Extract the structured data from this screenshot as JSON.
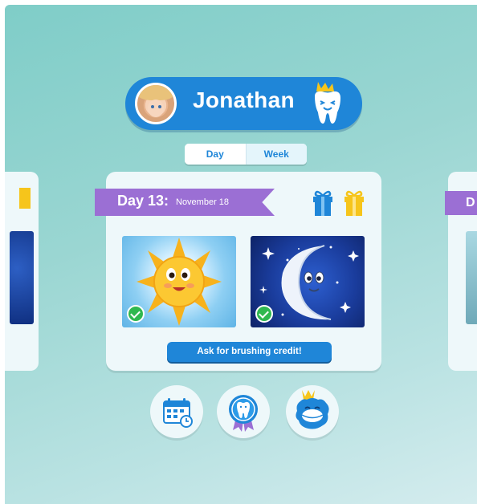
{
  "profile": {
    "name": "Jonathan"
  },
  "view_toggle": {
    "day_label": "Day",
    "week_label": "Week",
    "selected": "Week"
  },
  "card": {
    "day_label": "Day 13:",
    "date": "November 18",
    "morning_done": true,
    "evening_done": true,
    "ask_button": "Ask for brushing credit!"
  },
  "colors": {
    "accent_blue": "#1f86d8",
    "banner_purple": "#9b6fd4",
    "check_green": "#2fb84f",
    "gift_blue": "#1f86d8",
    "gift_yellow": "#f6c51b",
    "background_teal": "#8fd1cd"
  },
  "icons": [
    "tooth-crown-icon",
    "gift-icon",
    "calendar-icon",
    "tooth-badge-icon",
    "monster-crown-icon",
    "check-icon",
    "sun-icon",
    "moon-icon"
  ]
}
